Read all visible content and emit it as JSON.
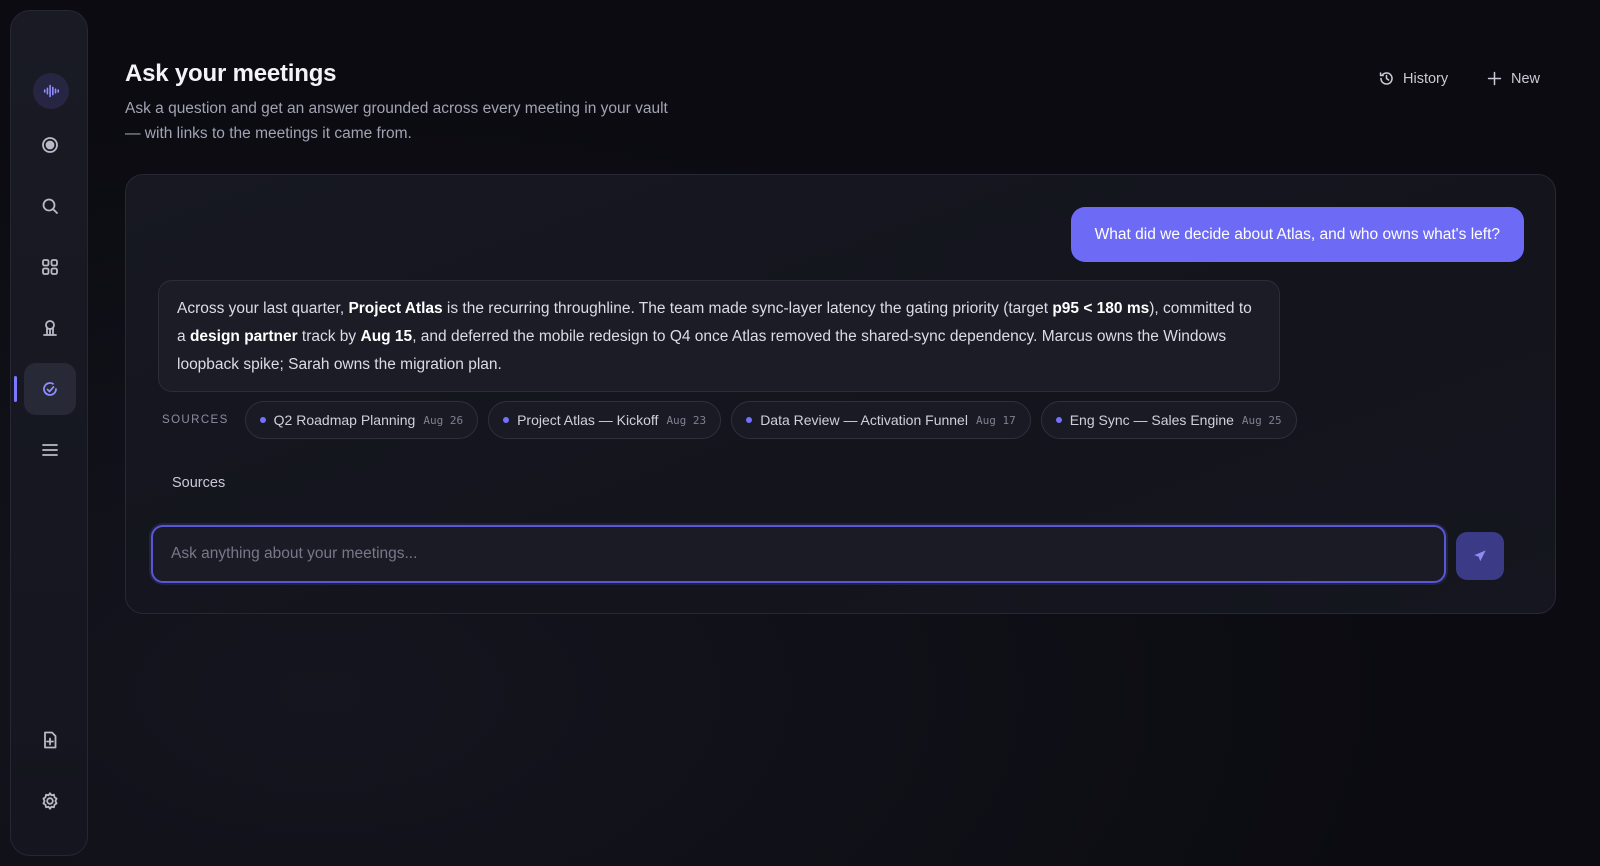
{
  "sidebar": {
    "items": [
      {
        "name": "audio-wave-icon",
        "label": "logo"
      },
      {
        "name": "record-icon"
      },
      {
        "name": "search-icon"
      },
      {
        "name": "grid-icon"
      },
      {
        "name": "people-icon"
      },
      {
        "name": "ask-icon"
      },
      {
        "name": "list-icon"
      },
      {
        "name": "document-add-icon"
      },
      {
        "name": "gear-icon"
      }
    ]
  },
  "header": {
    "title": "Ask your meetings",
    "subtitle": "Ask a question and get an answer grounded across every meeting in your vault — with links to the meetings it came from.",
    "history_label": "History",
    "new_label": "New"
  },
  "conversation": {
    "user_question": "What did we decide about Atlas, and who owns what's left?",
    "answer": {
      "p1": "Across your last quarter, ",
      "b1": "Project Atlas",
      "p2": " is the recurring throughline. The team made sync-layer latency the gating priority (target ",
      "b2": "p95 < 180 ms",
      "p3": "), committed to a ",
      "b3": "design partner",
      "p4": " track by ",
      "b4": "Aug 15",
      "p5": ", and deferred the mobile redesign to Q4 once Atlas removed the shared-sync dependency. Marcus owns the Windows loopback spike; Sarah owns the migration plan."
    },
    "sources_label": "SOURCES",
    "sources": [
      {
        "title": "Q2 Roadmap Planning",
        "date": "Aug 26"
      },
      {
        "title": "Project Atlas — Kickoff",
        "date": "Aug 23"
      },
      {
        "title": "Data Review — Activation Funnel",
        "date": "Aug 17"
      },
      {
        "title": "Eng Sync — Sales Engine",
        "date": "Aug 25"
      }
    ],
    "sources_toggle": "Sources"
  },
  "composer": {
    "placeholder": "Ask anything about your meetings...",
    "value": ""
  },
  "colors": {
    "accent": "#6d6bf6",
    "background": "#0b0b11",
    "panel": "#171822"
  }
}
